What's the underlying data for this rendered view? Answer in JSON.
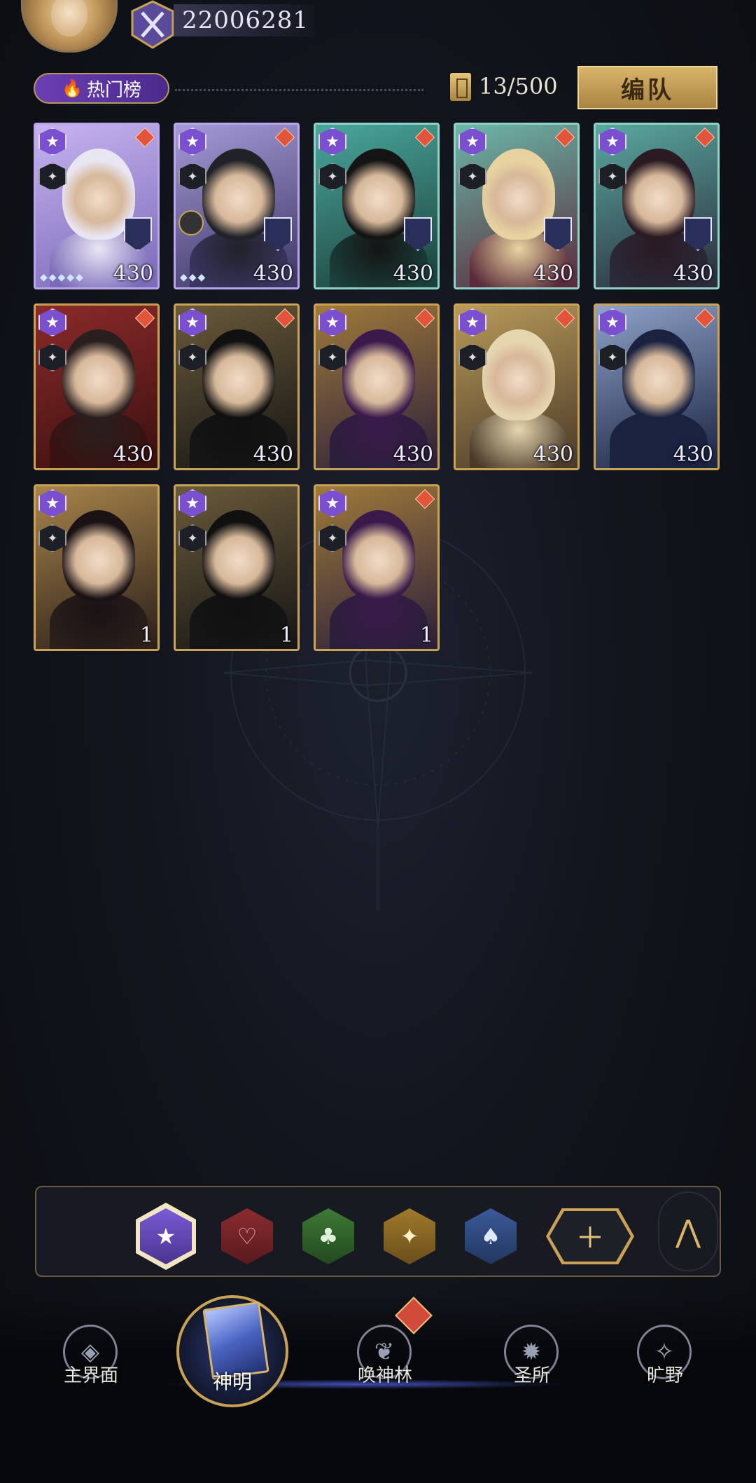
{
  "top_bar": {
    "power_value": "22006281"
  },
  "ranking": {
    "hot_tab_label": "热门榜",
    "card_count": "13/500",
    "team_button_label": "编队"
  },
  "heroes": [
    {
      "level": "430",
      "frame": "purple",
      "palette": [
        "#c7b3f0",
        "#7a6ab8"
      ],
      "hair": "#e9e6f4"
    },
    {
      "level": "430",
      "frame": "purple",
      "palette": [
        "#a59ad8",
        "#3b3562"
      ],
      "hair": "#202228"
    },
    {
      "level": "430",
      "frame": "teal",
      "palette": [
        "#4aa79d",
        "#1b3f3a"
      ],
      "hair": "#141414"
    },
    {
      "level": "430",
      "frame": "teal",
      "palette": [
        "#6bb7a9",
        "#5a2a3a"
      ],
      "hair": "#e8d3a0"
    },
    {
      "level": "430",
      "frame": "teal",
      "palette": [
        "#5aa9a0",
        "#2a2a3a"
      ],
      "hair": "#2a1a22"
    },
    {
      "level": "430",
      "frame": "gold",
      "palette": [
        "#8c2a2a",
        "#3a1010"
      ],
      "hair": "#2a1f1f"
    },
    {
      "level": "430",
      "frame": "gold",
      "palette": [
        "#6a5a3a",
        "#151515"
      ],
      "hair": "#101010"
    },
    {
      "level": "430",
      "frame": "gold",
      "palette": [
        "#a07a3a",
        "#2b1f3a"
      ],
      "hair": "#3a1a4a"
    },
    {
      "level": "430",
      "frame": "gold",
      "palette": [
        "#b89a5a",
        "#4a3a28"
      ],
      "hair": "#e6d6b0"
    },
    {
      "level": "430",
      "frame": "gold",
      "palette": [
        "#8fa2c9",
        "#1a2240"
      ],
      "hair": "#1a2240"
    },
    {
      "level": "1",
      "frame": "gold",
      "palette": [
        "#a8844a",
        "#2a1f1a"
      ],
      "hair": "#1a1215"
    },
    {
      "level": "1",
      "frame": "gold",
      "palette": [
        "#6a5a3a",
        "#151515"
      ],
      "hair": "#101010"
    },
    {
      "level": "1",
      "frame": "gold",
      "palette": [
        "#a07a3a",
        "#2b1f3a"
      ],
      "hair": "#3a1a4a"
    }
  ],
  "filters": [
    {
      "name": "all",
      "icon": "star-icon"
    },
    {
      "name": "heart",
      "icon": "heart-icon"
    },
    {
      "name": "club",
      "icon": "club-icon"
    },
    {
      "name": "diamond",
      "icon": "sparkle-icon"
    },
    {
      "name": "spade",
      "icon": "spade-icon"
    },
    {
      "name": "other",
      "icon": "grid-icon"
    }
  ],
  "bottom_nav": {
    "items": [
      {
        "label": "主界面"
      },
      {
        "label": "神明"
      },
      {
        "label": "唤神林"
      },
      {
        "label": "圣所"
      },
      {
        "label": "旷野"
      }
    ]
  },
  "colors": {
    "accent_gold": "#c9a256",
    "accent_purple": "#7a4fd0"
  }
}
